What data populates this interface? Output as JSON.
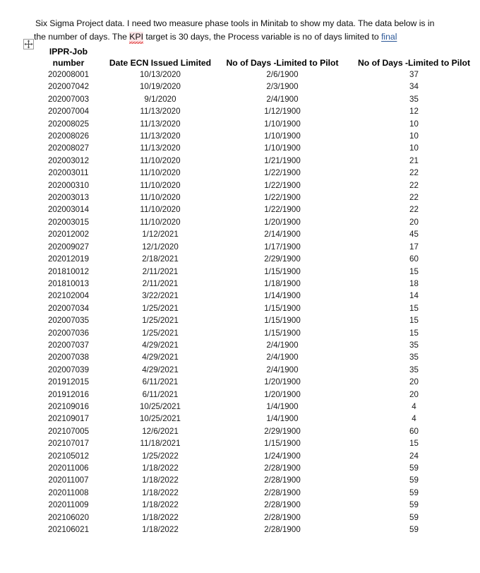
{
  "document": {
    "intro": {
      "line1": "Six Sigma Project data. I need two measure phase tools in Minitab to show my data. The data below is in",
      "line2_a": "the number of days. The ",
      "line2_misspelled": "KPI",
      "line2_b": " target is 30 days, the Process variable is no of days limited to ",
      "line2_link": "final"
    },
    "table_handle_icon": "move-cross-icon"
  },
  "table": {
    "headers": {
      "col1_line1": "IPPR-Job",
      "col1_line2": "number",
      "col2": "Date ECN Issued Limited",
      "col3": "No of Days -Limited to Pilot",
      "col4": "No of Days -Limited to Pilot"
    },
    "rows": [
      {
        "job": "202008001",
        "date_ecn": "10/13/2020",
        "pilot_date": "2/6/1900",
        "days": "37"
      },
      {
        "job": "202007042",
        "date_ecn": "10/19/2020",
        "pilot_date": "2/3/1900",
        "days": "34"
      },
      {
        "job": "202007003",
        "date_ecn": "9/1/2020",
        "pilot_date": "2/4/1900",
        "days": "35"
      },
      {
        "job": "202007004",
        "date_ecn": "11/13/2020",
        "pilot_date": "1/12/1900",
        "days": "12"
      },
      {
        "job": "202008025",
        "date_ecn": "11/13/2020",
        "pilot_date": "1/10/1900",
        "days": "10"
      },
      {
        "job": "202008026",
        "date_ecn": "11/13/2020",
        "pilot_date": "1/10/1900",
        "days": "10"
      },
      {
        "job": "202008027",
        "date_ecn": "11/13/2020",
        "pilot_date": "1/10/1900",
        "days": "10"
      },
      {
        "job": "202003012",
        "date_ecn": "11/10/2020",
        "pilot_date": "1/21/1900",
        "days": "21"
      },
      {
        "job": "202003011",
        "date_ecn": "11/10/2020",
        "pilot_date": "1/22/1900",
        "days": "22"
      },
      {
        "job": "202000310",
        "date_ecn": "11/10/2020",
        "pilot_date": "1/22/1900",
        "days": "22"
      },
      {
        "job": "202003013",
        "date_ecn": "11/10/2020",
        "pilot_date": "1/22/1900",
        "days": "22"
      },
      {
        "job": "202003014",
        "date_ecn": "11/10/2020",
        "pilot_date": "1/22/1900",
        "days": "22"
      },
      {
        "job": "202003015",
        "date_ecn": "11/10/2020",
        "pilot_date": "1/20/1900",
        "days": "20"
      },
      {
        "job": "202012002",
        "date_ecn": "1/12/2021",
        "pilot_date": "2/14/1900",
        "days": "45"
      },
      {
        "job": "202009027",
        "date_ecn": "12/1/2020",
        "pilot_date": "1/17/1900",
        "days": "17"
      },
      {
        "job": "202012019",
        "date_ecn": "2/18/2021",
        "pilot_date": "2/29/1900",
        "days": "60"
      },
      {
        "job": "201810012",
        "date_ecn": "2/11/2021",
        "pilot_date": "1/15/1900",
        "days": "15"
      },
      {
        "job": "201810013",
        "date_ecn": "2/11/2021",
        "pilot_date": "1/18/1900",
        "days": "18"
      },
      {
        "job": "202102004",
        "date_ecn": "3/22/2021",
        "pilot_date": "1/14/1900",
        "days": "14"
      },
      {
        "job": "202007034",
        "date_ecn": "1/25/2021",
        "pilot_date": "1/15/1900",
        "days": "15"
      },
      {
        "job": "202007035",
        "date_ecn": "1/25/2021",
        "pilot_date": "1/15/1900",
        "days": "15"
      },
      {
        "job": "202007036",
        "date_ecn": "1/25/2021",
        "pilot_date": "1/15/1900",
        "days": "15"
      },
      {
        "job": "202007037",
        "date_ecn": "4/29/2021",
        "pilot_date": "2/4/1900",
        "days": "35"
      },
      {
        "job": "202007038",
        "date_ecn": "4/29/2021",
        "pilot_date": "2/4/1900",
        "days": "35"
      },
      {
        "job": "202007039",
        "date_ecn": "4/29/2021",
        "pilot_date": "2/4/1900",
        "days": "35"
      },
      {
        "job": "201912015",
        "date_ecn": "6/11/2021",
        "pilot_date": "1/20/1900",
        "days": "20"
      },
      {
        "job": "201912016",
        "date_ecn": "6/11/2021",
        "pilot_date": "1/20/1900",
        "days": "20"
      },
      {
        "job": "202109016",
        "date_ecn": "10/25/2021",
        "pilot_date": "1/4/1900",
        "days": "4"
      },
      {
        "job": "202109017",
        "date_ecn": "10/25/2021",
        "pilot_date": "1/4/1900",
        "days": "4"
      },
      {
        "job": "202107005",
        "date_ecn": "12/6/2021",
        "pilot_date": "2/29/1900",
        "days": "60"
      },
      {
        "job": "202107017",
        "date_ecn": "11/18/2021",
        "pilot_date": "1/15/1900",
        "days": "15"
      },
      {
        "job": "202105012",
        "date_ecn": "1/25/2022",
        "pilot_date": "1/24/1900",
        "days": "24"
      },
      {
        "job": "202011006",
        "date_ecn": "1/18/2022",
        "pilot_date": "2/28/1900",
        "days": "59"
      },
      {
        "job": "202011007",
        "date_ecn": "1/18/2022",
        "pilot_date": "2/28/1900",
        "days": "59"
      },
      {
        "job": "202011008",
        "date_ecn": "1/18/2022",
        "pilot_date": "2/28/1900",
        "days": "59"
      },
      {
        "job": "202011009",
        "date_ecn": "1/18/2022",
        "pilot_date": "2/28/1900",
        "days": "59"
      },
      {
        "job": "202106020",
        "date_ecn": "1/18/2022",
        "pilot_date": "2/28/1900",
        "days": "59"
      },
      {
        "job": "202106021",
        "date_ecn": "1/18/2022",
        "pilot_date": "2/28/1900",
        "days": "59"
      }
    ]
  },
  "colors": {
    "page_background": "#ffffff",
    "text": "#000000",
    "hyperlink": "#2b5797",
    "spellcheck_underline": "#e03030",
    "spellcheck_highlight": "#fbe4e6",
    "handle_border": "#9a9a9a"
  }
}
